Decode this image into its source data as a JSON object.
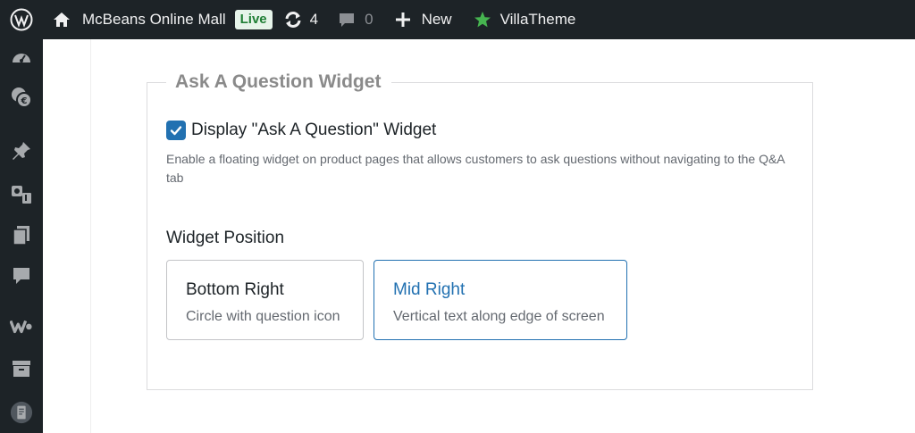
{
  "adminbar": {
    "site_name": "McBeans Online Mall",
    "live_badge": "Live",
    "updates_count": "4",
    "comments_count": "0",
    "new_label": "New",
    "villatheme_label": "VillaTheme"
  },
  "sidebar": {
    "icons": [
      "dashboard-icon",
      "woocommerce-currency-icon",
      "pin-icon",
      "media-icon",
      "pages-icon",
      "comments-icon",
      "woo-icon",
      "archive-icon",
      "plugin-icon"
    ]
  },
  "widget": {
    "legend": "Ask A Question Widget",
    "checkbox_label": "Display \"Ask A Question\" Widget",
    "checkbox_checked": true,
    "description": "Enable a floating widget on product pages that allows customers to ask questions without navigating to the Q&A tab",
    "position_heading": "Widget Position",
    "options": [
      {
        "title": "Bottom Right",
        "subtitle": "Circle with question icon",
        "selected": false
      },
      {
        "title": "Mid Right",
        "subtitle": "Vertical text along edge of screen",
        "selected": true
      }
    ]
  },
  "colors": {
    "adminbar_bg": "#1d2327",
    "accent": "#2271b1",
    "live_badge_bg": "#e6f4ea",
    "villatheme_star": "#46b450"
  }
}
